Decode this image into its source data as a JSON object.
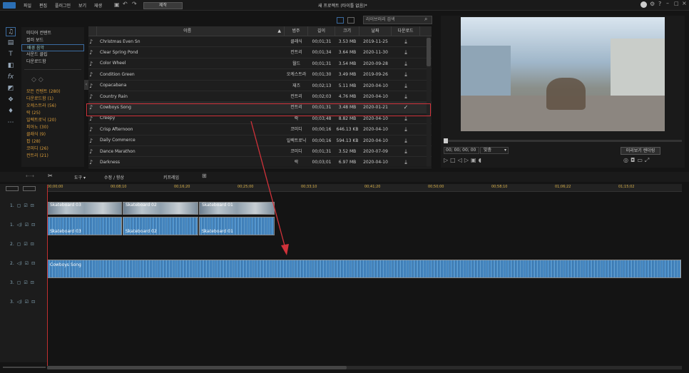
{
  "menu": [
    "파일",
    "편집",
    "플러그인",
    "보기",
    "재생"
  ],
  "produce_label": "제작",
  "window_title": "새 프로젝트 (타이틀 없음)*",
  "library": {
    "items": [
      "미디어 컨텐트",
      "컬러 보드",
      "배경 음악",
      "사운드 클립",
      "다운로드함"
    ],
    "selected_index": 2,
    "categories": [
      "모든 컨텐트 (280)",
      "다운로드함 (1)",
      "오케스트라 (56)",
      "락 (25)",
      "일렉트로닉 (20)",
      "피아노 (30)",
      "클래식 (9)",
      "팝 (28)",
      "코미디 (26)",
      "컨트리 (21)"
    ]
  },
  "search": {
    "placeholder": "라이브러리 검색"
  },
  "table": {
    "headers": [
      "이름",
      "범주",
      "길이",
      "크기",
      "날짜",
      "다운로드"
    ],
    "rows": [
      {
        "name": "Christmas Even Sn",
        "cat": "클래식",
        "len": "00;01;31",
        "size": "3.53 MB",
        "date": "2019-11-25",
        "dl": "download"
      },
      {
        "name": "Clear Spring Pond",
        "cat": "컨트리",
        "len": "00;01;34",
        "size": "3.64 MB",
        "date": "2020-11-30",
        "dl": "download"
      },
      {
        "name": "Color Wheel",
        "cat": "월드",
        "len": "00;01;31",
        "size": "3.54 MB",
        "date": "2020-09-28",
        "dl": "download"
      },
      {
        "name": "Condition Green",
        "cat": "오케스트라",
        "len": "00;01;30",
        "size": "3.49 MB",
        "date": "2019-09-26",
        "dl": "download"
      },
      {
        "name": "Copacabana",
        "cat": "재즈",
        "len": "00;02;13",
        "size": "5.11 MB",
        "date": "2020-04-10",
        "dl": "download"
      },
      {
        "name": "Country Rain",
        "cat": "컨트리",
        "len": "00;02;03",
        "size": "4.76 MB",
        "date": "2020-04-10",
        "dl": "download"
      },
      {
        "name": "Cowboys Song",
        "cat": "컨트리",
        "len": "00;01;31",
        "size": "3.48 MB",
        "date": "2020-01-21",
        "dl": "downloaded"
      },
      {
        "name": "Creepy",
        "cat": "락",
        "len": "00;03;48",
        "size": "8.82 MB",
        "date": "2020-04-10",
        "dl": "download"
      },
      {
        "name": "Crisp Afternoon",
        "cat": "코미디",
        "len": "00;00;16",
        "size": "646.13 KB",
        "date": "2020-04-10",
        "dl": "download"
      },
      {
        "name": "Daily Commerce",
        "cat": "일렉트로닉",
        "len": "00;00;16",
        "size": "594.13 KB",
        "date": "2020-04-10",
        "dl": "download"
      },
      {
        "name": "Dance Marathon",
        "cat": "코미디",
        "len": "00;01;31",
        "size": "3.52 MB",
        "date": "2020-07-09",
        "dl": "download"
      },
      {
        "name": "Darkness",
        "cat": "락",
        "len": "00;03;01",
        "size": "6.97 MB",
        "date": "2020-04-10",
        "dl": "download"
      }
    ],
    "highlight_index": 6
  },
  "preview": {
    "timecode": "00; 00; 00; 00",
    "fit": "맞춤",
    "quality_btn": "미리보기 렌더링"
  },
  "timeline_toolbar": {
    "tools": "도구",
    "edit": "수정 / 향상",
    "keyframe": "키프레임"
  },
  "ruler_ticks": [
    "00;00;00",
    "00;08;10",
    "00;16;20",
    "00;25;00",
    "00;33;10",
    "00;41;20",
    "00;50;00",
    "00;58;10",
    "01;06;22",
    "01;15;02"
  ],
  "tracks": {
    "labels": [
      "1.",
      "1.",
      "2.",
      "2.",
      "3.",
      "3."
    ],
    "video_clips": [
      "Skateboard 03",
      "Skateboard 02",
      "Skateboard 01"
    ],
    "audio_clips": [
      "Skateboard 03",
      "Skateboard 02",
      "Skateboard 01"
    ],
    "music_clip": "Cowboys Song"
  },
  "colors": {
    "accent": "#d79b3a",
    "highlight": "#d0323a",
    "playhead": "#c03030"
  }
}
